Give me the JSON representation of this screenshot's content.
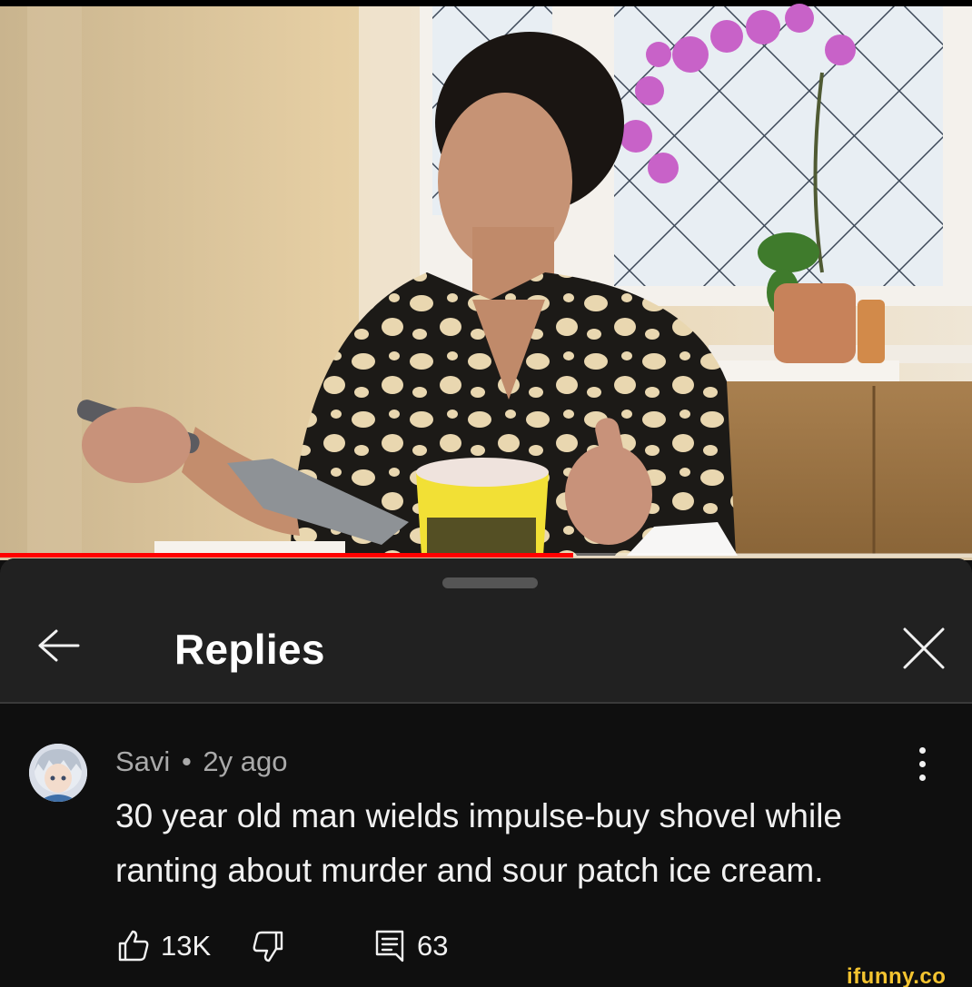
{
  "video": {
    "progress_fraction": 0.59
  },
  "sheet": {
    "title": "Replies"
  },
  "comment": {
    "author": "Savi",
    "separator": "•",
    "age": "2y ago",
    "text": "30 year old man wields impulse-buy shovel while ranting about murder and sour patch ice cream.",
    "likes": "13K",
    "replies": "63"
  },
  "icons": {
    "back": "arrow-left-icon",
    "close": "close-icon",
    "more": "more-vertical-icon",
    "like": "thumbs-up-icon",
    "dislike": "thumbs-down-icon",
    "reply": "comment-icon"
  },
  "watermark": "ifunny.co",
  "colors": {
    "progress": "#ff0000",
    "sheet_bg": "#0f0f0f",
    "header_bg": "#212121",
    "meta_text": "#aaaaaa",
    "watermark": "#f4c430"
  }
}
